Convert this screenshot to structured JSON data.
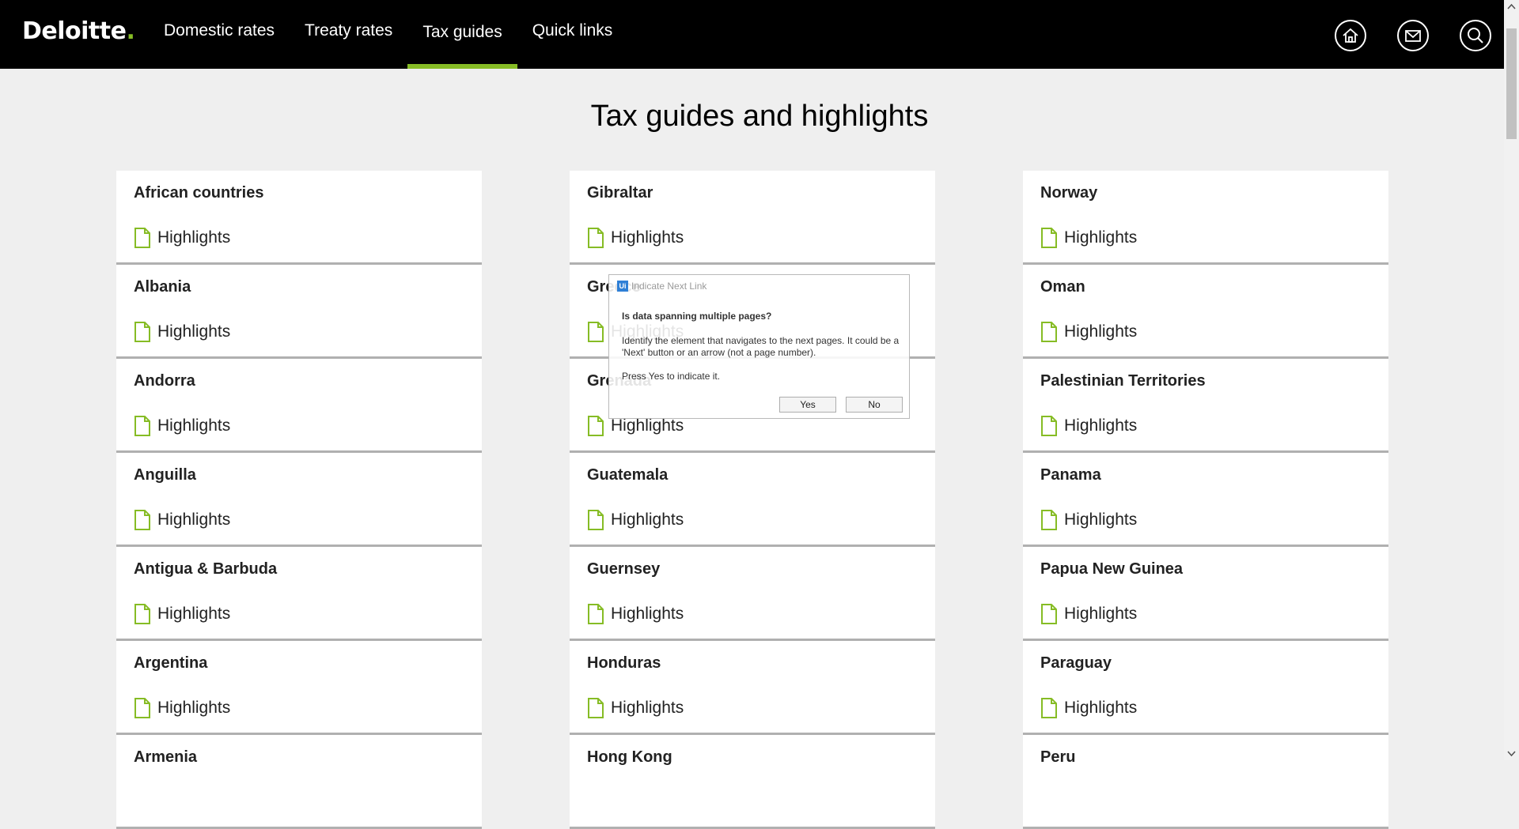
{
  "header": {
    "logo_text": "Deloitte",
    "logo_dot": ".",
    "nav": [
      {
        "label": "Domestic rates",
        "active": false
      },
      {
        "label": "Treaty rates",
        "active": false
      },
      {
        "label": "Tax guides",
        "active": true
      },
      {
        "label": "Quick links",
        "active": false
      }
    ],
    "icons": [
      "home-icon",
      "mail-icon",
      "search-icon"
    ]
  },
  "page_title": "Tax guides and highlights",
  "columns": [
    [
      "African countries",
      "Albania",
      "Andorra",
      "Anguilla",
      "Antigua & Barbuda",
      "Argentina",
      "Armenia"
    ],
    [
      "Gibraltar",
      "Greece",
      "Grenada",
      "Guatemala",
      "Guernsey",
      "Honduras",
      "Hong Kong"
    ],
    [
      "Norway",
      "Oman",
      "Palestinian Territories",
      "Panama",
      "Papua New Guinea",
      "Paraguay",
      "Peru"
    ]
  ],
  "highlight_label": "Highlights",
  "dialog": {
    "title": "Indicate Next Link",
    "logo": "Ui",
    "question": "Is data spanning multiple pages?",
    "description": "Identify the element that navigates to the next pages. It could be a 'Next' button or an arrow (not a page number).",
    "press_text": "Press Yes to indicate it.",
    "yes": "Yes",
    "no": "No"
  },
  "colors": {
    "accent": "#86bc25",
    "header_bg": "#000000",
    "page_bg": "#efefef"
  }
}
